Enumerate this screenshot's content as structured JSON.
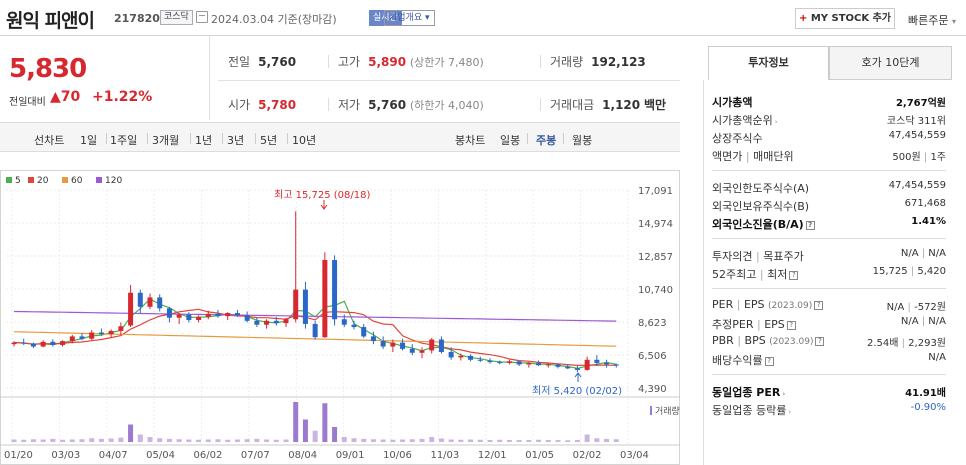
{
  "stock": {
    "name": "원익 피앤이",
    "code": "217820",
    "market": "코스닥",
    "date": "2024.03.04",
    "basis": "기준(장마감)",
    "live": "실시간",
    "corp_info": "기업개요",
    "my_stock": "MY STOCK 추가",
    "my_stock_plus": "+",
    "quick_order": "빠른주문"
  },
  "price": {
    "current": "5,830",
    "change_label": "전일대비",
    "change": "70",
    "change_pct": "+1.22%"
  },
  "metrics": {
    "prev": {
      "label": "전일",
      "value": "5,760"
    },
    "high": {
      "label": "고가",
      "value": "5,890",
      "sub": "(상한가 7,480)"
    },
    "volume": {
      "label": "거래량",
      "value": "192,123"
    },
    "open": {
      "label": "시가",
      "value": "5,780"
    },
    "low": {
      "label": "저가",
      "value": "5,760",
      "sub": "(하한가 4,040)"
    },
    "amount": {
      "label": "거래대금",
      "value": "1,120",
      "unit": "백만"
    }
  },
  "periods": {
    "line": "선차트",
    "items": [
      "1일",
      "1주일",
      "3개월",
      "1년",
      "3년",
      "5년",
      "10년"
    ],
    "candle": "봉차트",
    "candle_items": [
      "일봉",
      "주봉",
      "월봉"
    ],
    "selected": "주봉"
  },
  "legend": [
    {
      "label": "5",
      "color": "#4caf50"
    },
    {
      "label": "20",
      "color": "#e0453a"
    },
    {
      "label": "60",
      "color": "#e89a40"
    },
    {
      "label": "120",
      "color": "#9c5ad2"
    }
  ],
  "chart_data": {
    "type": "candlestick",
    "x_labels": [
      "01/20",
      "03/03",
      "04/07",
      "05/04",
      "06/02",
      "07/07",
      "08/04",
      "09/01",
      "10/06",
      "11/03",
      "12/01",
      "01/05",
      "02/02",
      "03/04"
    ],
    "y_ticks": [
      "17,091",
      "14,974",
      "12,857",
      "10,740",
      "8,623",
      "6,506",
      "4,390"
    ],
    "ylim": [
      4390,
      17091
    ],
    "annotation_high": "최고 15,725 (08/18)",
    "annotation_low": "최저 5,420 (02/02)",
    "volume_label": "거래량",
    "candles": [
      [
        7200,
        7400,
        7050,
        7300
      ],
      [
        7300,
        7550,
        7150,
        7250
      ],
      [
        7250,
        7300,
        6950,
        7050
      ],
      [
        7050,
        7450,
        7000,
        7350
      ],
      [
        7350,
        7500,
        7050,
        7150
      ],
      [
        7150,
        7450,
        7050,
        7400
      ],
      [
        7400,
        7800,
        7250,
        7700
      ],
      [
        7700,
        7900,
        7450,
        7550
      ],
      [
        7550,
        8100,
        7450,
        7950
      ],
      [
        7950,
        8200,
        7750,
        7850
      ],
      [
        7850,
        8150,
        7600,
        8050
      ],
      [
        8050,
        8600,
        7800,
        8350
      ],
      [
        8400,
        11000,
        8300,
        10500
      ],
      [
        10500,
        10700,
        9200,
        9600
      ],
      [
        9600,
        10450,
        9450,
        10200
      ],
      [
        10200,
        10400,
        9300,
        9500
      ],
      [
        9500,
        9600,
        8600,
        8900
      ],
      [
        8900,
        9200,
        8500,
        9100
      ],
      [
        9100,
        9250,
        8600,
        8750
      ],
      [
        8750,
        9050,
        8600,
        8950
      ],
      [
        8950,
        9350,
        8800,
        9150
      ],
      [
        9150,
        9400,
        8900,
        9000
      ],
      [
        9000,
        9250,
        8750,
        9200
      ],
      [
        9200,
        9400,
        8950,
        9050
      ],
      [
        9050,
        9300,
        8600,
        8700
      ],
      [
        8700,
        8900,
        8300,
        8450
      ],
      [
        8450,
        8800,
        8200,
        8700
      ],
      [
        8700,
        8950,
        8400,
        8550
      ],
      [
        8550,
        8900,
        8300,
        8800
      ],
      [
        8800,
        15725,
        8600,
        10700
      ],
      [
        10700,
        11200,
        8200,
        8500
      ],
      [
        8500,
        8700,
        7500,
        7650
      ],
      [
        7650,
        13100,
        7600,
        12600
      ],
      [
        12600,
        12900,
        8400,
        8800
      ],
      [
        8800,
        9100,
        8300,
        8450
      ],
      [
        8450,
        8700,
        8150,
        8300
      ],
      [
        8300,
        8500,
        7600,
        7700
      ],
      [
        7700,
        8000,
        7200,
        7400
      ],
      [
        7400,
        7700,
        6900,
        7050
      ],
      [
        7050,
        7500,
        6700,
        7300
      ],
      [
        7300,
        7550,
        6800,
        6900
      ],
      [
        6900,
        7200,
        6500,
        6650
      ],
      [
        6650,
        7000,
        6300,
        6800
      ],
      [
        6800,
        7600,
        6600,
        7500
      ],
      [
        7500,
        7700,
        6600,
        6700
      ],
      [
        6700,
        7000,
        6200,
        6350
      ],
      [
        6350,
        6600,
        6150,
        6450
      ],
      [
        6450,
        6550,
        6100,
        6200
      ],
      [
        6200,
        6400,
        6050,
        6150
      ],
      [
        6150,
        6300,
        5950,
        6050
      ],
      [
        6050,
        6150,
        5900,
        6000
      ],
      [
        6000,
        6200,
        5900,
        6100
      ],
      [
        6100,
        6150,
        5800,
        5900
      ],
      [
        5900,
        6050,
        5700,
        6000
      ],
      [
        6000,
        6150,
        5800,
        5850
      ],
      [
        5850,
        6000,
        5700,
        5900
      ],
      [
        5900,
        5950,
        5650,
        5750
      ],
      [
        5750,
        5900,
        5600,
        5650
      ],
      [
        5650,
        5800,
        5420,
        5550
      ],
      [
        5550,
        6400,
        5500,
        6200
      ],
      [
        6200,
        6500,
        5800,
        6000
      ],
      [
        6000,
        6200,
        5700,
        5900
      ],
      [
        5900,
        5950,
        5700,
        5830
      ]
    ],
    "volumes": [
      20,
      18,
      22,
      20,
      25,
      18,
      20,
      22,
      30,
      25,
      28,
      35,
      140,
      60,
      40,
      30,
      25,
      22,
      20,
      18,
      20,
      22,
      18,
      20,
      22,
      25,
      20,
      18,
      20,
      320,
      180,
      90,
      310,
      120,
      40,
      30,
      25,
      22,
      20,
      18,
      20,
      22,
      25,
      40,
      28,
      20,
      18,
      20,
      18,
      16,
      18,
      16,
      15,
      16,
      18,
      16,
      15,
      14,
      16,
      60,
      30,
      25,
      22
    ]
  },
  "panel": {
    "tab_active": "투자정보",
    "tab_other": "호가 10단계",
    "g1": [
      {
        "k": "시가총액",
        "v": "2,767억원",
        "bold": true
      },
      {
        "k": "시가총액순위",
        "v": "코스닥 311위",
        "arrow": "›"
      },
      {
        "k": "상장주식수",
        "v": "47,454,559"
      },
      {
        "k": "액면가",
        "k2": "매매단위",
        "v": "500원",
        "v2": "1주"
      }
    ],
    "g2": [
      {
        "k": "외국인한도주식수(A)",
        "v": "47,454,559"
      },
      {
        "k": "외국인보유주식수(B)",
        "v": "671,468"
      },
      {
        "k": "외국인소진율(B/A)",
        "v": "1.41%",
        "bold": true,
        "q": "?"
      }
    ],
    "g3": [
      {
        "k": "투자의견",
        "k2": "목표주가",
        "v": "N/A",
        "v2": "N/A"
      },
      {
        "k": "52주최고",
        "k2": "최저",
        "v": "15,725",
        "v2": "5,420",
        "q": "?"
      }
    ],
    "g4": [
      {
        "k": "PER",
        "k2": "EPS",
        "k3": "(2023.09)",
        "v": "N/A",
        "v2": "-572원",
        "q": "?"
      },
      {
        "k": "추정PER",
        "k2": "EPS",
        "v": "N/A",
        "v2": "N/A",
        "q": "?"
      },
      {
        "k": "PBR",
        "k2": "BPS",
        "k3": "(2023.09)",
        "v": "2.54배",
        "v2": "2,293원",
        "q": "?"
      },
      {
        "k": "배당수익률",
        "v": "N/A",
        "q": "?"
      }
    ],
    "g5": [
      {
        "k": "동일업종 PER",
        "v": "41.91배",
        "bold": true,
        "arrow": "›"
      },
      {
        "k": "동일업종 등락률",
        "v": "-0.90%",
        "arrow": "›",
        "red": true
      }
    ]
  }
}
